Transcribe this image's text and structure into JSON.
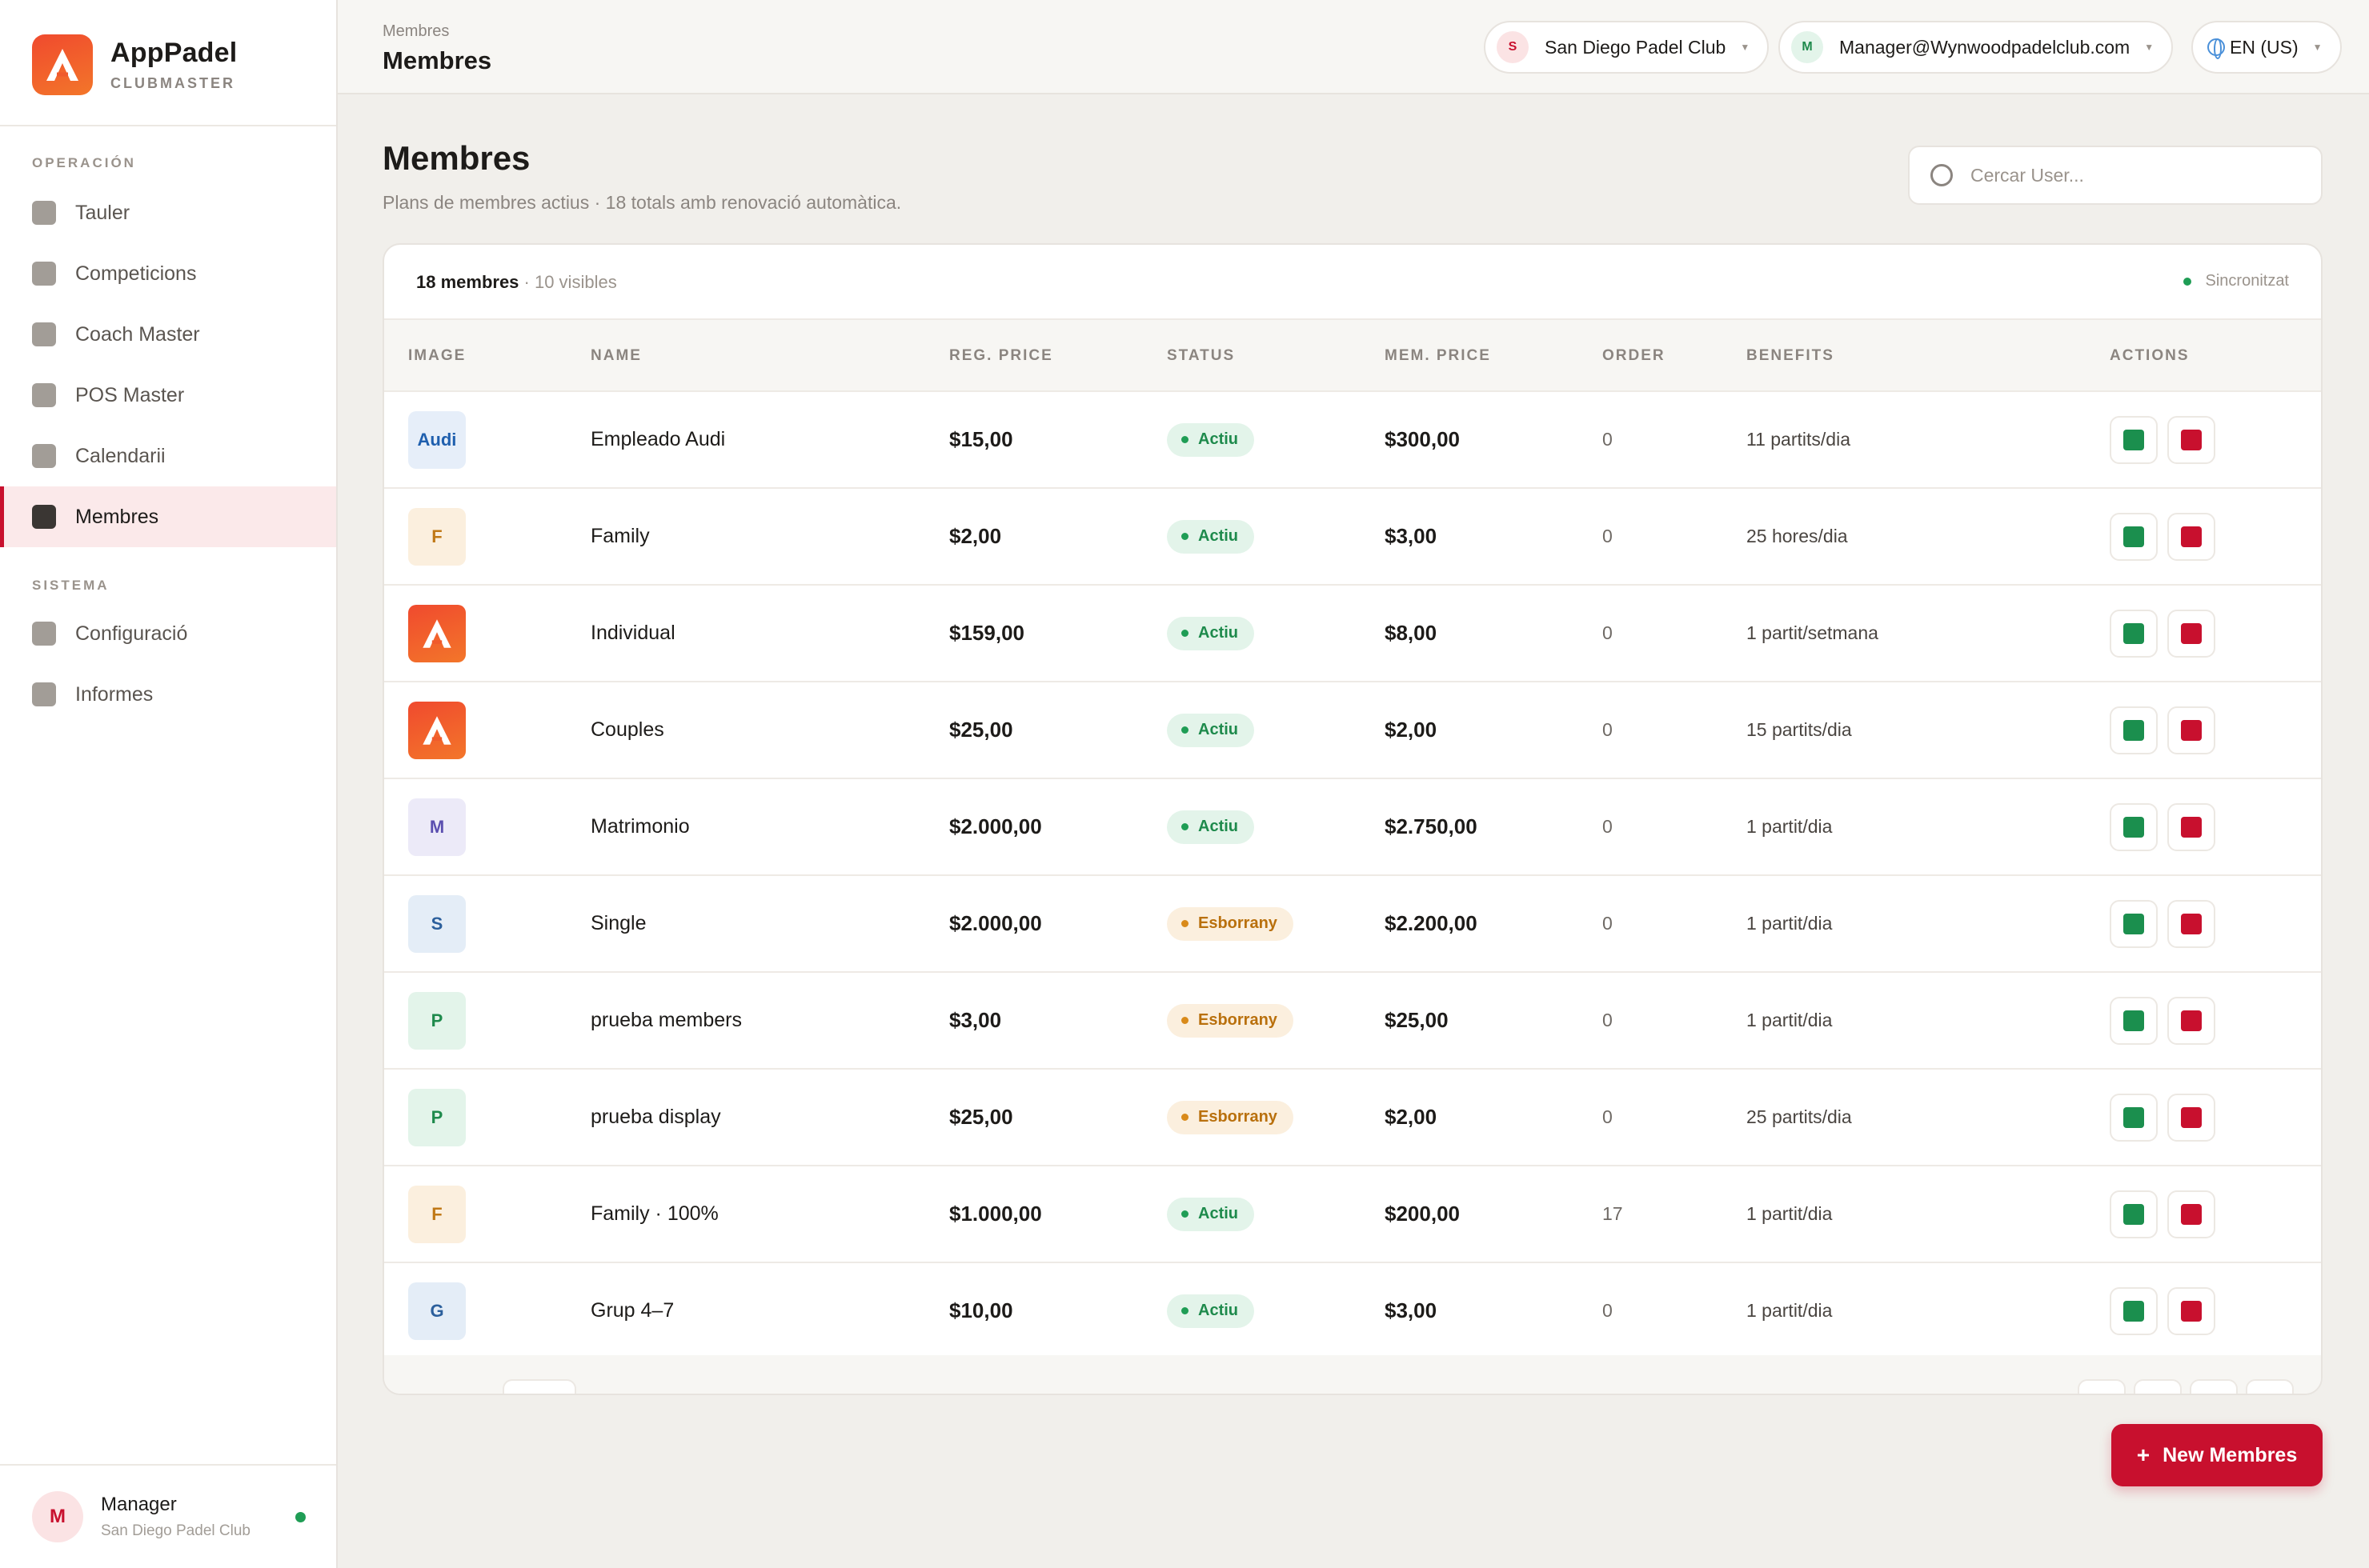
{
  "brand": {
    "title": "AppPadel",
    "subtitle": "CLUBMASTER"
  },
  "sidebar": {
    "section_operacion": "OPERACIÓN",
    "section_sistema": "SISTEMA",
    "items": [
      {
        "label": "Tauler",
        "icon": "dashboard-icon"
      },
      {
        "label": "Competicions",
        "icon": "trophy-icon"
      },
      {
        "label": "Coach Master",
        "icon": "coach-icon"
      },
      {
        "label": "POS Master",
        "icon": "pos-icon"
      },
      {
        "label": "Calendarii",
        "icon": "calendar-icon"
      },
      {
        "label": "Membres",
        "icon": "members-icon",
        "active": true
      },
      {
        "label": "Configuració",
        "icon": "settings-icon"
      },
      {
        "label": "Informes",
        "icon": "reports-icon"
      }
    ],
    "user": {
      "avatar": "M",
      "name": "Manager",
      "club": "San Diego Padel Club"
    }
  },
  "topbar": {
    "breadcrumb_small": "Membres",
    "breadcrumb_title": "Membres",
    "club": {
      "avatar": "S",
      "label": "San Diego Padel Club"
    },
    "account": {
      "avatar": "M",
      "label": "Manager@Wynwoodpadelclub.com"
    },
    "language": "EN (US)"
  },
  "main": {
    "title": "Membres",
    "subtitle": "Plans de membres actius · 18 totals amb renovació automàtica.",
    "search_placeholder": "Cercar User...",
    "count_bold": "18 membres",
    "count_rest": " · 10 visibles",
    "sync_status": "Sincronitzat",
    "new_button": "New Membres"
  },
  "table": {
    "columns": [
      "IMAGE",
      "NAME",
      "REG. PRICE",
      "STATUS",
      "MEM. PRICE",
      "ORDER",
      "BENEFITS",
      "ACTIONS"
    ],
    "rows": [
      {
        "thumb": "Audi",
        "thumb_style": "audi",
        "name": "Empleado Audi",
        "reg_price": "$15,00",
        "status": "Actiu",
        "status_kind": "green",
        "mem_price": "$300,00",
        "order": "0",
        "benefits": "11 partits/dia"
      },
      {
        "thumb": "F",
        "thumb_style": "orange",
        "name": "Family",
        "reg_price": "$2,00",
        "status": "Actiu",
        "status_kind": "green",
        "mem_price": "$3,00",
        "order": "0",
        "benefits": "25 hores/dia"
      },
      {
        "thumb": "",
        "thumb_style": "logo",
        "name": "Individual",
        "reg_price": "$159,00",
        "status": "Actiu",
        "status_kind": "green",
        "mem_price": "$8,00",
        "order": "0",
        "benefits": "1 partit/setmana"
      },
      {
        "thumb": "",
        "thumb_style": "logo",
        "name": "Couples",
        "reg_price": "$25,00",
        "status": "Actiu",
        "status_kind": "green",
        "mem_price": "$2,00",
        "order": "0",
        "benefits": "15 partits/dia"
      },
      {
        "thumb": "M",
        "thumb_style": "purple",
        "name": "Matrimonio",
        "reg_price": "$2.000,00",
        "status": "Actiu",
        "status_kind": "green",
        "mem_price": "$2.750,00",
        "order": "0",
        "benefits": "1 partit/dia"
      },
      {
        "thumb": "S",
        "thumb_style": "blue",
        "name": "Single",
        "reg_price": "$2.000,00",
        "status": "Esborrany",
        "status_kind": "amber",
        "mem_price": "$2.200,00",
        "order": "0",
        "benefits": "1 partit/dia"
      },
      {
        "thumb": "P",
        "thumb_style": "green",
        "name": "prueba members",
        "reg_price": "$3,00",
        "status": "Esborrany",
        "status_kind": "amber",
        "mem_price": "$25,00",
        "order": "0",
        "benefits": "1 partit/dia"
      },
      {
        "thumb": "P",
        "thumb_style": "green",
        "name": "prueba display",
        "reg_price": "$25,00",
        "status": "Esborrany",
        "status_kind": "amber",
        "mem_price": "$2,00",
        "order": "0",
        "benefits": "25 partits/dia"
      },
      {
        "thumb": "F",
        "thumb_style": "orange",
        "name": "Family · 100%",
        "reg_price": "$1.000,00",
        "status": "Actiu",
        "status_kind": "green",
        "mem_price": "$200,00",
        "order": "17",
        "benefits": "1 partit/dia"
      },
      {
        "thumb": "G",
        "thumb_style": "blue",
        "name": "Grup 4–7",
        "reg_price": "$10,00",
        "status": "Actiu",
        "status_kind": "green",
        "mem_price": "$3,00",
        "order": "0",
        "benefits": "1 partit/dia"
      }
    ]
  },
  "colors": {
    "accent": "#c8102e",
    "success": "#1f9d55",
    "draft": "#d98a1a"
  }
}
